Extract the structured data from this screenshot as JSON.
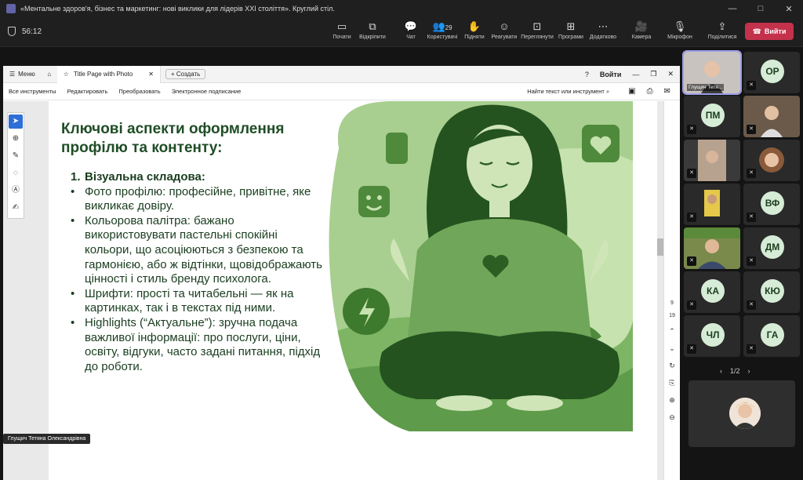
{
  "window": {
    "title": "«Ментальне здоров'я, бізнес та маркетинг: нові виклики для лідерів XXI століття». Круглий стіл.",
    "min": "—",
    "max": "□",
    "close": "✕"
  },
  "call": {
    "timer": "56:12",
    "buttons": [
      {
        "label": "Почати",
        "icon": "▭"
      },
      {
        "label": "Відкріпити",
        "icon": "⧉"
      },
      {
        "label": "Чат",
        "icon": "💬"
      },
      {
        "label": "Користувачі",
        "icon": "👥",
        "count": "29"
      },
      {
        "label": "Підняти",
        "icon": "✋"
      },
      {
        "label": "Реагувати",
        "icon": "☺"
      },
      {
        "label": "Переглянути",
        "icon": "⊡"
      },
      {
        "label": "Програми",
        "icon": "⊞"
      },
      {
        "label": "Додатково",
        "icon": "⋯"
      },
      {
        "label": "Камера",
        "icon": "🎥"
      },
      {
        "label": "Мікрофон",
        "icon": "🎙"
      },
      {
        "label": "Поділитися",
        "icon": "⇪"
      }
    ],
    "leave_label": "Вийти"
  },
  "pdf": {
    "menu_label": "Меню",
    "tab_title": "Title Page with Photo",
    "new_tab": "Создать",
    "signin": "Войти",
    "help": "?",
    "toolbar": [
      "Все инструменты",
      "Редактировать",
      "Преобразовать",
      "Электронное подписание"
    ],
    "search": "Найти текст или инструмент",
    "page_numbers": [
      "9",
      "19"
    ]
  },
  "slide": {
    "title": "Ключові аспекти оформлення профілю та контенту:",
    "items": [
      {
        "marker": "1.",
        "text": "Візуальна складова:",
        "bold": true
      },
      {
        "marker": "•",
        "text": "Фото профілю: професійне, привітне, яке викликає довіру."
      },
      {
        "marker": "•",
        "text": "Кольорова палітра: бажано використовувати пастельні спокійні кольори, що асоціюються з безпекою та гармонією, або ж відтінки, щовідображають цінності і стиль бренду психолога."
      },
      {
        "marker": "•",
        "text": "Шрифти: прості та читабельні — як на картинках, так і в текстах під ними."
      },
      {
        "marker": "•",
        "text": "Highlights (“Актуальне”): зручна подача важливої інформації: про послуги, ціни, освіту, відгуки, часто задані питання, підхід до роботи."
      }
    ]
  },
  "presenter_name": "Глущич Тетяна Олександрівна",
  "participants": [
    {
      "label": "Глущич Тетя...",
      "photo": true
    },
    {
      "initials": "ОР"
    },
    {
      "initials": "ПМ"
    },
    {
      "photo": true
    },
    {
      "photo": true
    },
    {
      "photo": true
    },
    {
      "photo": true
    },
    {
      "initials": "ВФ"
    },
    {
      "photo": true
    },
    {
      "initials": "ДМ"
    },
    {
      "initials": "КА"
    },
    {
      "initials": "КЮ"
    },
    {
      "initials": "ЧЛ"
    },
    {
      "initials": "ГА"
    }
  ],
  "pager": {
    "prev": "‹",
    "text": "1/2",
    "next": "›"
  },
  "colors": {
    "accent": "#c4314b",
    "slide_green": "#1f4d26",
    "illustration_bg": "#a8cf8f"
  }
}
